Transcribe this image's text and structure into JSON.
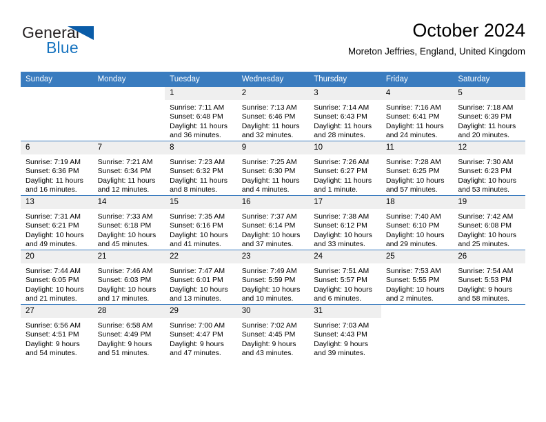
{
  "brand": {
    "name_part1": "General",
    "name_part2": "Blue",
    "accent_color": "#1673bf",
    "triangle_color": "#0a5ca8"
  },
  "header": {
    "title": "October 2024",
    "subtitle": "Moreton Jeffries, England, United Kingdom"
  },
  "theme": {
    "header_row_bg": "#3a7cbf",
    "header_row_text": "#ffffff",
    "daynum_band_bg": "#efefef",
    "grid_line": "#3a7cbf",
    "page_bg": "#ffffff"
  },
  "calendar": {
    "weekday_headers": [
      "Sunday",
      "Monday",
      "Tuesday",
      "Wednesday",
      "Thursday",
      "Friday",
      "Saturday"
    ],
    "labels": {
      "sunrise": "Sunrise:",
      "sunset": "Sunset:",
      "daylight": "Daylight:"
    },
    "weeks": [
      [
        {
          "blank": true
        },
        {
          "blank": true
        },
        {
          "day": "1",
          "sunrise": "Sunrise: 7:11 AM",
          "sunset": "Sunset: 6:48 PM",
          "daylight_line1": "Daylight: 11 hours",
          "daylight_line2": "and 36 minutes."
        },
        {
          "day": "2",
          "sunrise": "Sunrise: 7:13 AM",
          "sunset": "Sunset: 6:46 PM",
          "daylight_line1": "Daylight: 11 hours",
          "daylight_line2": "and 32 minutes."
        },
        {
          "day": "3",
          "sunrise": "Sunrise: 7:14 AM",
          "sunset": "Sunset: 6:43 PM",
          "daylight_line1": "Daylight: 11 hours",
          "daylight_line2": "and 28 minutes."
        },
        {
          "day": "4",
          "sunrise": "Sunrise: 7:16 AM",
          "sunset": "Sunset: 6:41 PM",
          "daylight_line1": "Daylight: 11 hours",
          "daylight_line2": "and 24 minutes."
        },
        {
          "day": "5",
          "sunrise": "Sunrise: 7:18 AM",
          "sunset": "Sunset: 6:39 PM",
          "daylight_line1": "Daylight: 11 hours",
          "daylight_line2": "and 20 minutes."
        }
      ],
      [
        {
          "day": "6",
          "sunrise": "Sunrise: 7:19 AM",
          "sunset": "Sunset: 6:36 PM",
          "daylight_line1": "Daylight: 11 hours",
          "daylight_line2": "and 16 minutes."
        },
        {
          "day": "7",
          "sunrise": "Sunrise: 7:21 AM",
          "sunset": "Sunset: 6:34 PM",
          "daylight_line1": "Daylight: 11 hours",
          "daylight_line2": "and 12 minutes."
        },
        {
          "day": "8",
          "sunrise": "Sunrise: 7:23 AM",
          "sunset": "Sunset: 6:32 PM",
          "daylight_line1": "Daylight: 11 hours",
          "daylight_line2": "and 8 minutes."
        },
        {
          "day": "9",
          "sunrise": "Sunrise: 7:25 AM",
          "sunset": "Sunset: 6:30 PM",
          "daylight_line1": "Daylight: 11 hours",
          "daylight_line2": "and 4 minutes."
        },
        {
          "day": "10",
          "sunrise": "Sunrise: 7:26 AM",
          "sunset": "Sunset: 6:27 PM",
          "daylight_line1": "Daylight: 11 hours",
          "daylight_line2": "and 1 minute."
        },
        {
          "day": "11",
          "sunrise": "Sunrise: 7:28 AM",
          "sunset": "Sunset: 6:25 PM",
          "daylight_line1": "Daylight: 10 hours",
          "daylight_line2": "and 57 minutes."
        },
        {
          "day": "12",
          "sunrise": "Sunrise: 7:30 AM",
          "sunset": "Sunset: 6:23 PM",
          "daylight_line1": "Daylight: 10 hours",
          "daylight_line2": "and 53 minutes."
        }
      ],
      [
        {
          "day": "13",
          "sunrise": "Sunrise: 7:31 AM",
          "sunset": "Sunset: 6:21 PM",
          "daylight_line1": "Daylight: 10 hours",
          "daylight_line2": "and 49 minutes."
        },
        {
          "day": "14",
          "sunrise": "Sunrise: 7:33 AM",
          "sunset": "Sunset: 6:18 PM",
          "daylight_line1": "Daylight: 10 hours",
          "daylight_line2": "and 45 minutes."
        },
        {
          "day": "15",
          "sunrise": "Sunrise: 7:35 AM",
          "sunset": "Sunset: 6:16 PM",
          "daylight_line1": "Daylight: 10 hours",
          "daylight_line2": "and 41 minutes."
        },
        {
          "day": "16",
          "sunrise": "Sunrise: 7:37 AM",
          "sunset": "Sunset: 6:14 PM",
          "daylight_line1": "Daylight: 10 hours",
          "daylight_line2": "and 37 minutes."
        },
        {
          "day": "17",
          "sunrise": "Sunrise: 7:38 AM",
          "sunset": "Sunset: 6:12 PM",
          "daylight_line1": "Daylight: 10 hours",
          "daylight_line2": "and 33 minutes."
        },
        {
          "day": "18",
          "sunrise": "Sunrise: 7:40 AM",
          "sunset": "Sunset: 6:10 PM",
          "daylight_line1": "Daylight: 10 hours",
          "daylight_line2": "and 29 minutes."
        },
        {
          "day": "19",
          "sunrise": "Sunrise: 7:42 AM",
          "sunset": "Sunset: 6:08 PM",
          "daylight_line1": "Daylight: 10 hours",
          "daylight_line2": "and 25 minutes."
        }
      ],
      [
        {
          "day": "20",
          "sunrise": "Sunrise: 7:44 AM",
          "sunset": "Sunset: 6:05 PM",
          "daylight_line1": "Daylight: 10 hours",
          "daylight_line2": "and 21 minutes."
        },
        {
          "day": "21",
          "sunrise": "Sunrise: 7:46 AM",
          "sunset": "Sunset: 6:03 PM",
          "daylight_line1": "Daylight: 10 hours",
          "daylight_line2": "and 17 minutes."
        },
        {
          "day": "22",
          "sunrise": "Sunrise: 7:47 AM",
          "sunset": "Sunset: 6:01 PM",
          "daylight_line1": "Daylight: 10 hours",
          "daylight_line2": "and 13 minutes."
        },
        {
          "day": "23",
          "sunrise": "Sunrise: 7:49 AM",
          "sunset": "Sunset: 5:59 PM",
          "daylight_line1": "Daylight: 10 hours",
          "daylight_line2": "and 10 minutes."
        },
        {
          "day": "24",
          "sunrise": "Sunrise: 7:51 AM",
          "sunset": "Sunset: 5:57 PM",
          "daylight_line1": "Daylight: 10 hours",
          "daylight_line2": "and 6 minutes."
        },
        {
          "day": "25",
          "sunrise": "Sunrise: 7:53 AM",
          "sunset": "Sunset: 5:55 PM",
          "daylight_line1": "Daylight: 10 hours",
          "daylight_line2": "and 2 minutes."
        },
        {
          "day": "26",
          "sunrise": "Sunrise: 7:54 AM",
          "sunset": "Sunset: 5:53 PM",
          "daylight_line1": "Daylight: 9 hours",
          "daylight_line2": "and 58 minutes."
        }
      ],
      [
        {
          "day": "27",
          "sunrise": "Sunrise: 6:56 AM",
          "sunset": "Sunset: 4:51 PM",
          "daylight_line1": "Daylight: 9 hours",
          "daylight_line2": "and 54 minutes."
        },
        {
          "day": "28",
          "sunrise": "Sunrise: 6:58 AM",
          "sunset": "Sunset: 4:49 PM",
          "daylight_line1": "Daylight: 9 hours",
          "daylight_line2": "and 51 minutes."
        },
        {
          "day": "29",
          "sunrise": "Sunrise: 7:00 AM",
          "sunset": "Sunset: 4:47 PM",
          "daylight_line1": "Daylight: 9 hours",
          "daylight_line2": "and 47 minutes."
        },
        {
          "day": "30",
          "sunrise": "Sunrise: 7:02 AM",
          "sunset": "Sunset: 4:45 PM",
          "daylight_line1": "Daylight: 9 hours",
          "daylight_line2": "and 43 minutes."
        },
        {
          "day": "31",
          "sunrise": "Sunrise: 7:03 AM",
          "sunset": "Sunset: 4:43 PM",
          "daylight_line1": "Daylight: 9 hours",
          "daylight_line2": "and 39 minutes."
        },
        {
          "blank": true
        },
        {
          "blank": true
        }
      ]
    ]
  }
}
